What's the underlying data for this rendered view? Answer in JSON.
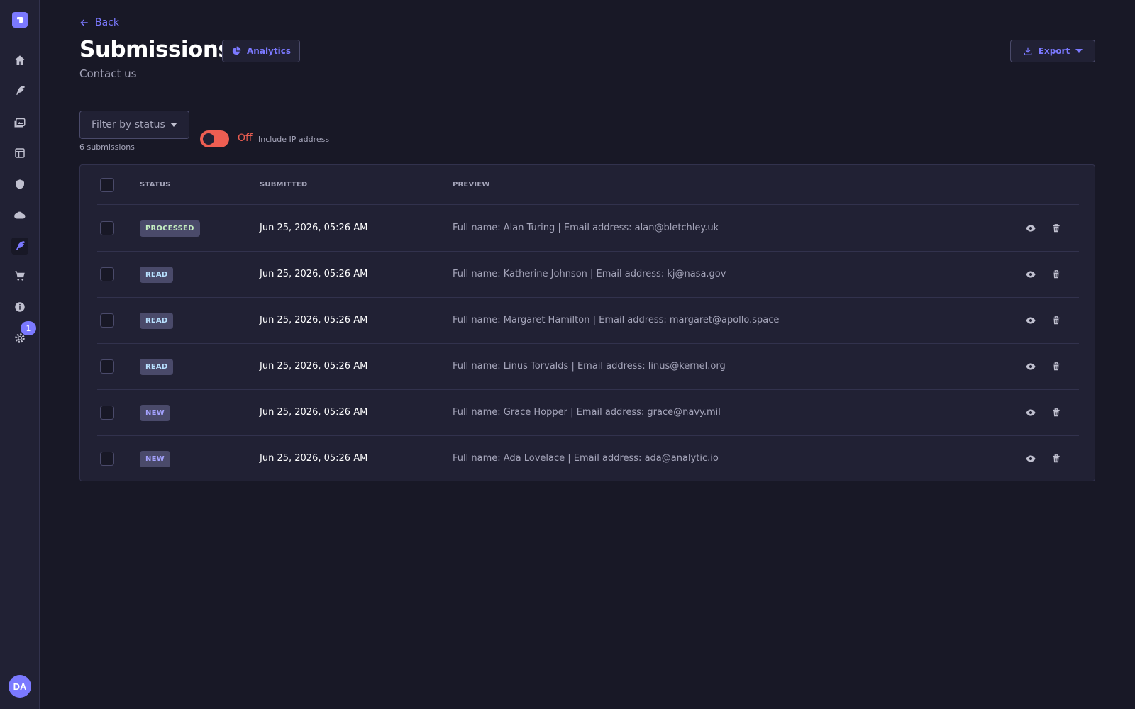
{
  "sidebar": {
    "items": [
      {
        "name": "home-icon"
      },
      {
        "name": "feather-icon"
      },
      {
        "name": "media-library-icon"
      },
      {
        "name": "layout-icon"
      },
      {
        "name": "shield-icon"
      },
      {
        "name": "cloud-icon"
      },
      {
        "name": "forms-icon",
        "active": true
      },
      {
        "name": "cart-icon"
      },
      {
        "name": "info-icon"
      },
      {
        "name": "gear-icon"
      }
    ],
    "settings_badge": "1",
    "avatar_initials": "DA"
  },
  "header": {
    "back_label": "Back",
    "title": "Submissions",
    "analytics_label": "Analytics",
    "subtitle": "Contact us",
    "export_label": "Export"
  },
  "filters": {
    "status_placeholder": "Filter by status",
    "count_text": "6 submissions",
    "toggle_state": "Off",
    "toggle_description": "Include IP address"
  },
  "table": {
    "columns": [
      "STATUS",
      "SUBMITTED",
      "PREVIEW"
    ],
    "rows": [
      {
        "status": "PROCESSED",
        "status_kind": "processed",
        "submitted": "Jun 25, 2026, 05:26 AM",
        "preview": "Full name: Alan Turing | Email address: alan@bletchley.uk"
      },
      {
        "status": "READ",
        "status_kind": "read",
        "submitted": "Jun 25, 2026, 05:26 AM",
        "preview": "Full name: Katherine Johnson | Email address: kj@nasa.gov"
      },
      {
        "status": "READ",
        "status_kind": "read",
        "submitted": "Jun 25, 2026, 05:26 AM",
        "preview": "Full name: Margaret Hamilton | Email address: margaret@apollo.space"
      },
      {
        "status": "READ",
        "status_kind": "read",
        "submitted": "Jun 25, 2026, 05:26 AM",
        "preview": "Full name: Linus Torvalds | Email address: linus@kernel.org"
      },
      {
        "status": "NEW",
        "status_kind": "new",
        "submitted": "Jun 25, 2026, 05:26 AM",
        "preview": "Full name: Grace Hopper | Email address: grace@navy.mil"
      },
      {
        "status": "NEW",
        "status_kind": "new",
        "submitted": "Jun 25, 2026, 05:26 AM",
        "preview": "Full name: Ada Lovelace | Email address: ada@analytic.io"
      }
    ]
  },
  "colors": {
    "accent": "#7b79ff",
    "background": "#181826",
    "surface": "#212134",
    "danger": "#ee5e52"
  }
}
